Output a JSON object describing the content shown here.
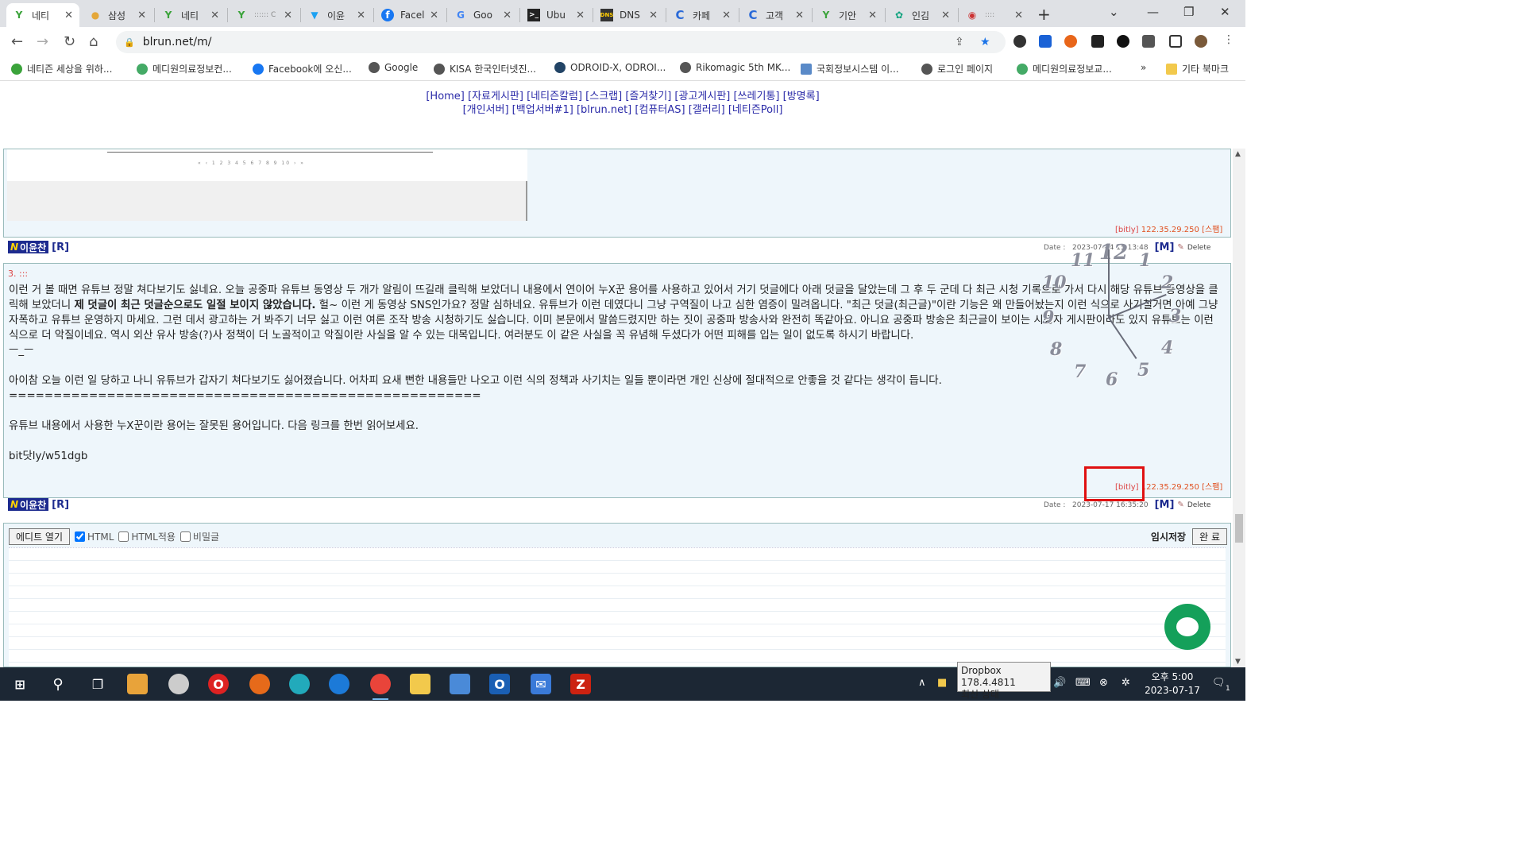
{
  "browser": {
    "tabs": [
      {
        "label": "네티",
        "icon": "sprout-icon",
        "active": true
      },
      {
        "label": "삼성",
        "icon": "globe-icon"
      },
      {
        "label": "네티",
        "icon": "sprout-icon"
      },
      {
        "label": ":::::: C",
        "icon": "sprout-icon"
      },
      {
        "label": "이윤",
        "icon": "twitter-icon"
      },
      {
        "label": "Facel",
        "icon": "facebook-icon"
      },
      {
        "label": "Goo",
        "icon": "google-icon"
      },
      {
        "label": "Ubu",
        "icon": "terminal-icon"
      },
      {
        "label": "DNS",
        "icon": "dns-icon"
      },
      {
        "label": "카페",
        "icon": "c-icon"
      },
      {
        "label": "고객",
        "icon": "c-icon"
      },
      {
        "label": "기안",
        "icon": "sprout-icon"
      },
      {
        "label": "인김",
        "icon": "chatgpt-icon"
      },
      {
        "label": ":::: ",
        "icon": "shield-icon"
      }
    ],
    "url": "blrun.net/m/",
    "bookmarks": [
      {
        "label": "네티즌 세상을 위하...",
        "icon": "sprout-icon"
      },
      {
        "label": "메디원의료정보컨...",
        "icon": "atom-icon"
      },
      {
        "label": "Facebook에 오신...",
        "icon": "facebook-icon"
      },
      {
        "label": "Google",
        "icon": "globe-icon"
      },
      {
        "label": "KISA 한국인터넷진...",
        "icon": "globe-icon"
      },
      {
        "label": "ODROID-X, ODROI...",
        "icon": "robot-icon"
      },
      {
        "label": "Rikomagic 5th MK...",
        "icon": "globe-icon"
      },
      {
        "label": "국회정보시스템 이...",
        "icon": "building-icon"
      },
      {
        "label": "로그인 페이지",
        "icon": "globe-icon"
      },
      {
        "label": "메디원의료정보교...",
        "icon": "atom-icon"
      }
    ],
    "bookmarks_more": "»",
    "other_bookmarks": "기타 북마크"
  },
  "page": {
    "nav_line1": "[Home] [자료게시판] [네티즌칼럼] [스크랩] [즐겨찾기] [광고게시판] [쓰레기통] [방명록]",
    "nav_line2": "[개인서버] [백업서버#1] [blrun.net] [컴퓨터AS] [갤러리] [네티즌Poll]",
    "post1": {
      "pager": "« ‹ 1 2 3 4 5 6 7 8 9 10 › »",
      "bitly": "[bitly]",
      "ip": "122.35.29.250",
      "spam": "[스팸]",
      "author": "이윤찬",
      "r": "[R]",
      "date_label": "Date :",
      "date": "2023-07-04 15:13:48",
      "m": "[M]",
      "delete": "Delete"
    },
    "post2": {
      "num": "3. :::",
      "para1_a": "이런 거 볼 때면 유튜브 정말 쳐다보기도 싫네요. 오늘 공중파 유튜브 동영상 두 개가 알림이 뜨길래 클릭해 보았더니 내용에서 연이어 누X꾼 용어를 사용하고 있어서 거기 덧글에다 아래 덧글을 달았는데 그 후 두 군데 다 최근 시청 기록으로 가서 다시 해당 유튜브 동영상을 클릭해 보았더니 ",
      "para1_bold": "제 덧글이 최근 덧글순으로도 일절 보이지 않았습니다.",
      "para1_b": " 헐~ 이런 게 동영상 SNS인가요? 정말 심하네요. 유튜브가 이런 데였다니 그냥 구역질이 나고 심한 염증이 밀려옵니다. \"최근 덧글(최근글)\"이란 기능은 왜 만들어놨는지 이런 식으로 사기칠거면 아예 그냥 자폭하고 유튜브 운영하지 마세요. 그런 데서 광고하는 거 봐주기 너무 싫고 이런 여론 조작 방송 시청하기도 싫습니다. 이미 본문에서 말씀드렸지만 하는 짓이 공중파 방송사와 완전히 똑같아요. 아니요 공중파 방송은 최근글이 보이는 시청자 게시판이라도 있지 유튜브는 이런 식으로 더 악질이네요. 역시 외산 유사 방송(?)사 정책이 더 노골적이고 악질이란 사실을 알 수 있는 대목입니다. 여러분도 이 같은 사실을 꼭 유념해 두셨다가 어떤 피해를 입는 일이 없도록 하시기 바랍니다.",
      "emoticon": "ㅡ_ㅡ",
      "para2": "아이참 오늘 이런 일 당하고 나니 유튜브가 갑자기 쳐다보기도 싫어졌습니다. 어차피 요새 뻔한 내용들만 나오고 이런 식의 정책과 사기치는 일들 뿐이라면 개인 신상에 절대적으로 안좋을 것 같다는 생각이 듭니다.",
      "divider": "=====================================================",
      "para3": "유튜브 내용에서 사용한 누X꾼이란 용어는 잘못된 용어입니다. 다음 링크를 한번 읽어보세요.",
      "link": "bit닷ly/w51dgb",
      "bitly": "[bitly]",
      "ip": "122.35.29.250",
      "spam": "[스팸]",
      "author": "이윤찬",
      "r": "[R]",
      "date_label": "Date :",
      "date": "2023-07-17 16:35:20",
      "m": "[M]",
      "delete": "Delete"
    },
    "clock_numbers": [
      "12",
      "1",
      "2",
      "3",
      "4",
      "5",
      "6",
      "7",
      "8",
      "9",
      "10",
      "11"
    ],
    "editor": {
      "open_button": "에디트 열기",
      "html_label": "HTML",
      "html_apply_label": "HTML적용",
      "secret_label": "비밀글",
      "temp_save": "임시저장",
      "done_button": "완 료"
    }
  },
  "taskbar": {
    "tooltip_line1": "Dropbox 178.4.4811",
    "tooltip_line2": "최신 상태",
    "clock_time": "오후 5:00",
    "clock_date": "2023-07-17",
    "notification_count": "1",
    "accent": "#76b9ed"
  }
}
